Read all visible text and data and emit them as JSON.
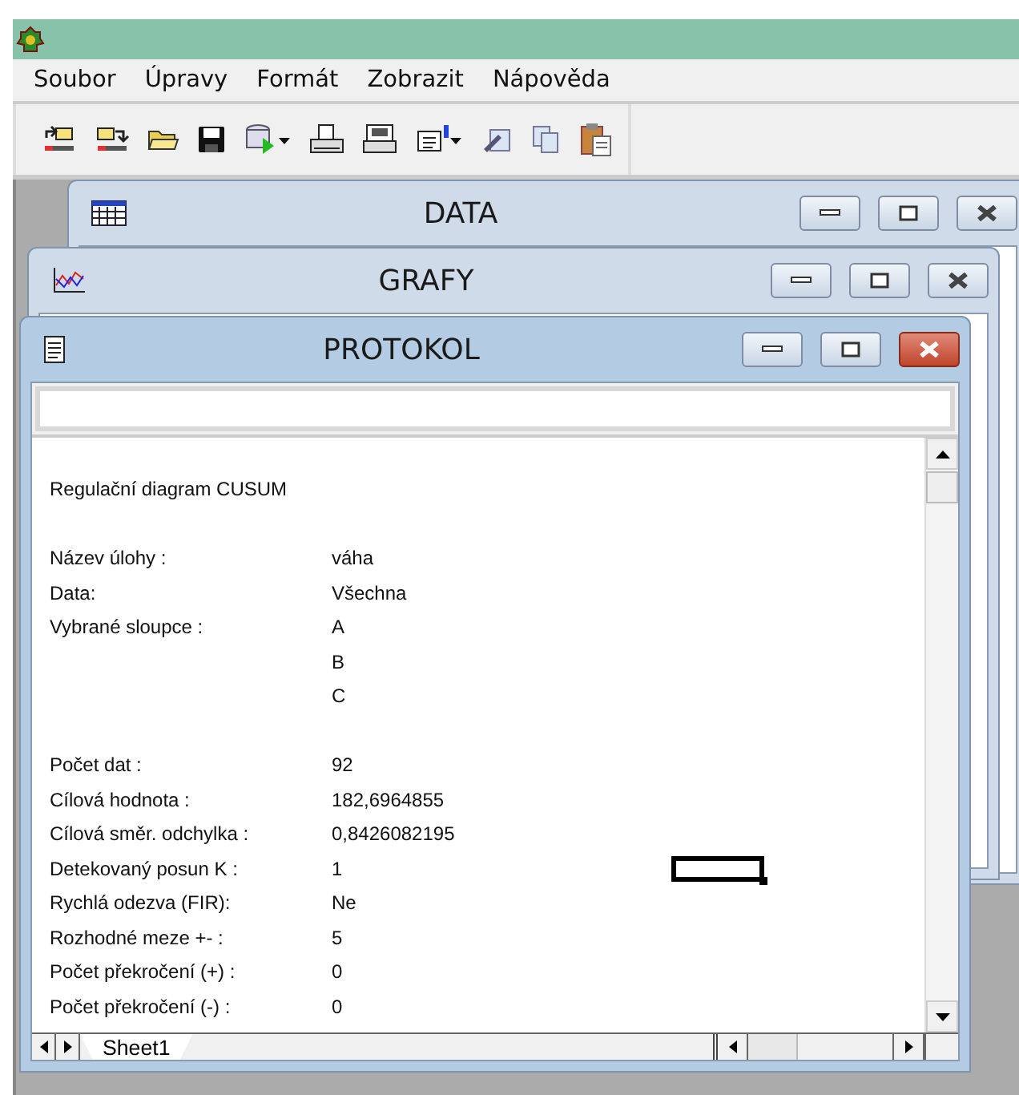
{
  "menu": [
    {
      "label": "Soubor"
    },
    {
      "label": "Úpravy"
    },
    {
      "label": "Formát"
    },
    {
      "label": "Zobrazit"
    },
    {
      "label": "Nápověda"
    }
  ],
  "windows": [
    {
      "kind": "table",
      "title": "DATA",
      "active": false
    },
    {
      "kind": "chart",
      "title": "GRAFY",
      "active": false
    },
    {
      "kind": "document",
      "title": "PROTOKOL",
      "active": true
    }
  ],
  "protocol": {
    "rows": [
      {
        "label": "",
        "value": "",
        "selected": false
      },
      {
        "label": "Regulační diagram CUSUM",
        "value": "",
        "selected": false
      },
      {
        "label": "",
        "value": "",
        "selected": false
      },
      {
        "label": "Název úlohy :",
        "value": "váha",
        "selected": false
      },
      {
        "label": "Data:",
        "value": "Všechna",
        "selected": false
      },
      {
        "label": "Vybrané sloupce :",
        "value": "A",
        "selected": false
      },
      {
        "label": "",
        "value": "B",
        "selected": false
      },
      {
        "label": "",
        "value": "C",
        "selected": false
      },
      {
        "label": "",
        "value": "",
        "selected": false
      },
      {
        "label": "Počet dat :",
        "value": "92",
        "selected": false
      },
      {
        "label": "Cílová hodnota :",
        "value": "182,6964855",
        "selected": false
      },
      {
        "label": "Cílová směr. odchylka :",
        "value": "0,8426082195",
        "selected": false
      },
      {
        "label": "Detekovaný posun K :",
        "value": "1",
        "selected": true
      },
      {
        "label": "Rychlá odezva (FIR):",
        "value": "Ne",
        "selected": false
      },
      {
        "label": "Rozhodné meze +- :",
        "value": "5",
        "selected": false
      },
      {
        "label": "Počet překročení (+) :",
        "value": "0",
        "selected": false
      },
      {
        "label": "Počet překročení (-) :",
        "value": "0",
        "selected": false
      }
    ],
    "sheet_tabs": [
      {
        "label": "Sheet1",
        "selected": true
      }
    ]
  }
}
